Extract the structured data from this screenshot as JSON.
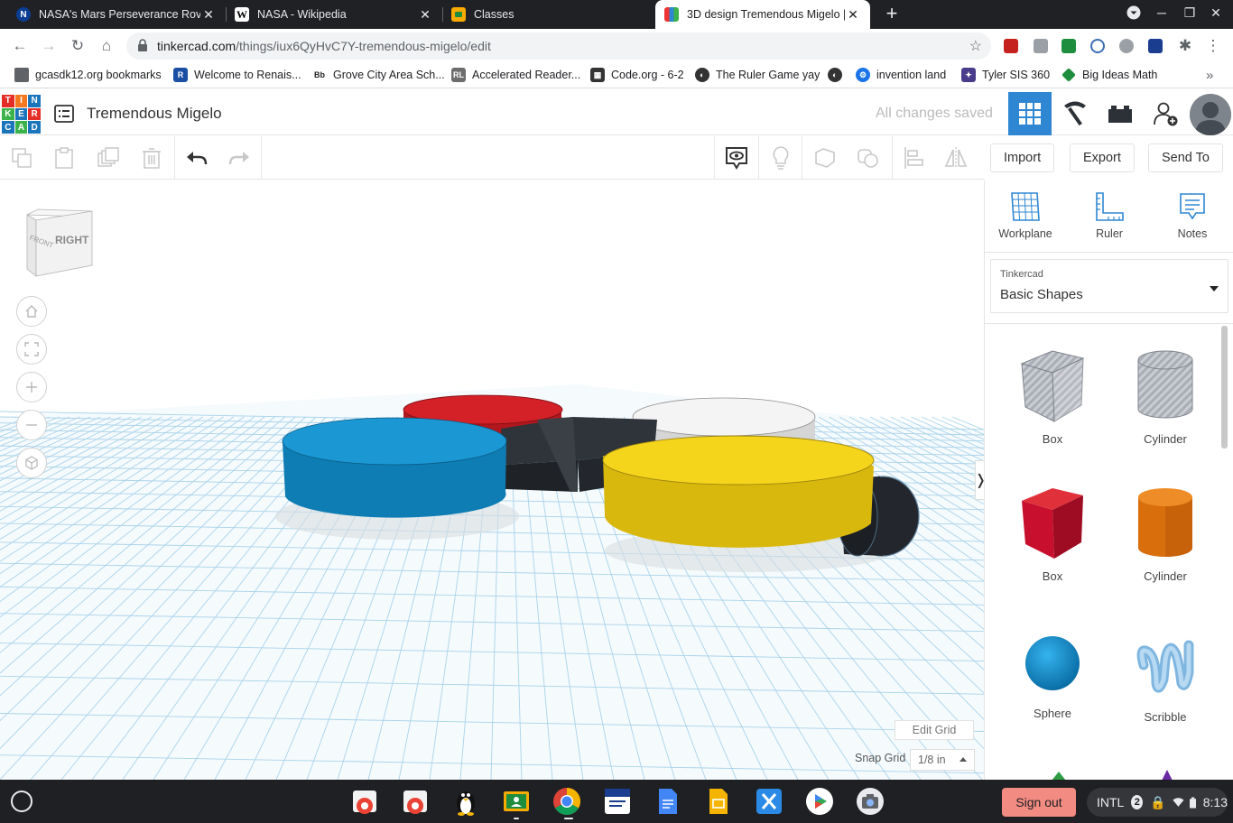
{
  "browser": {
    "tabs": [
      {
        "title": "NASA's Mars Perseverance Rove",
        "favicon": "nasa-icon",
        "color": "#0b3d91"
      },
      {
        "title": "NASA - Wikipedia",
        "favicon": "wikipedia-icon",
        "color": "#ffffff"
      },
      {
        "title": "Classes",
        "favicon": "google-classroom-icon",
        "color": "#f9ab00"
      },
      {
        "title": "3D design Tremendous Migelo |",
        "favicon": "tinkercad-icon",
        "color": "#2f86d2"
      }
    ],
    "url_host": "tinkercad.com",
    "url_path": "/things/iux6QyHvC7Y-tremendous-migelo/edit"
  },
  "bookmarks": [
    {
      "label": "gcasdk12.org bookmarks",
      "icon": "folder-icon",
      "color": "#5f6368"
    },
    {
      "label": "Welcome to Renais...",
      "icon": "renaissance-icon",
      "color": "#1a4fa3"
    },
    {
      "label": "Grove City Area Sch...",
      "icon": "blackboard-icon",
      "color": "#222222"
    },
    {
      "label": "Accelerated Reader...",
      "icon": "accelerated-reader-icon",
      "color": "#6d6d6d"
    },
    {
      "label": "Code.org - 6-2",
      "icon": "code-org-icon",
      "color": "#333333"
    },
    {
      "label": "The Ruler Game yay",
      "icon": "globe-icon",
      "color": "#333333"
    },
    {
      "label": "",
      "icon": "globe-icon",
      "color": "#333333"
    },
    {
      "label": "invention land",
      "icon": "gear-icon",
      "color": "#1a73e8"
    },
    {
      "label": "Tyler SIS 360",
      "icon": "tyler-icon",
      "color": "#4a3c8c"
    },
    {
      "label": "Big Ideas Math",
      "icon": "big-ideas-icon",
      "color": "#1e8e3e"
    }
  ],
  "tinkercad": {
    "logo_letters": [
      "T",
      "I",
      "N",
      "K",
      "E",
      "R",
      "C",
      "A",
      "D"
    ],
    "design_title": "Tremendous Migelo",
    "save_status": "All changes saved",
    "toolbar_right": {
      "import": "Import",
      "export": "Export",
      "send_to": "Send To"
    },
    "panel": {
      "workplane": "Workplane",
      "ruler": "Ruler",
      "notes": "Notes",
      "library_source": "Tinkercad",
      "library_name": "Basic Shapes"
    },
    "shapes": [
      {
        "label": "Box",
        "kind": "box-hole",
        "color": "#b8bcc4"
      },
      {
        "label": "Cylinder",
        "kind": "cylinder-hole",
        "color": "#b8bcc4"
      },
      {
        "label": "Box",
        "kind": "box",
        "color": "#c8102e"
      },
      {
        "label": "Cylinder",
        "kind": "cylinder",
        "color": "#e07b10"
      },
      {
        "label": "Sphere",
        "kind": "sphere",
        "color": "#0f8fd1"
      },
      {
        "label": "Scribble",
        "kind": "scribble",
        "color": "#8fc2e8"
      }
    ],
    "viewcube": {
      "front": "FRONT",
      "right": "RIGHT"
    },
    "edit_grid": "Edit Grid",
    "snap_grid_label": "Snap Grid",
    "snap_grid_value": "1/8 in",
    "scene_colors": {
      "blue": "#1390c8",
      "red": "#d42027",
      "white": "#eeeeee",
      "yellow": "#f2d114",
      "black": "#23272d"
    }
  },
  "shelf": {
    "sign_out": "Sign out",
    "ime": "INTL",
    "notification_count": "2",
    "time": "8:13"
  }
}
